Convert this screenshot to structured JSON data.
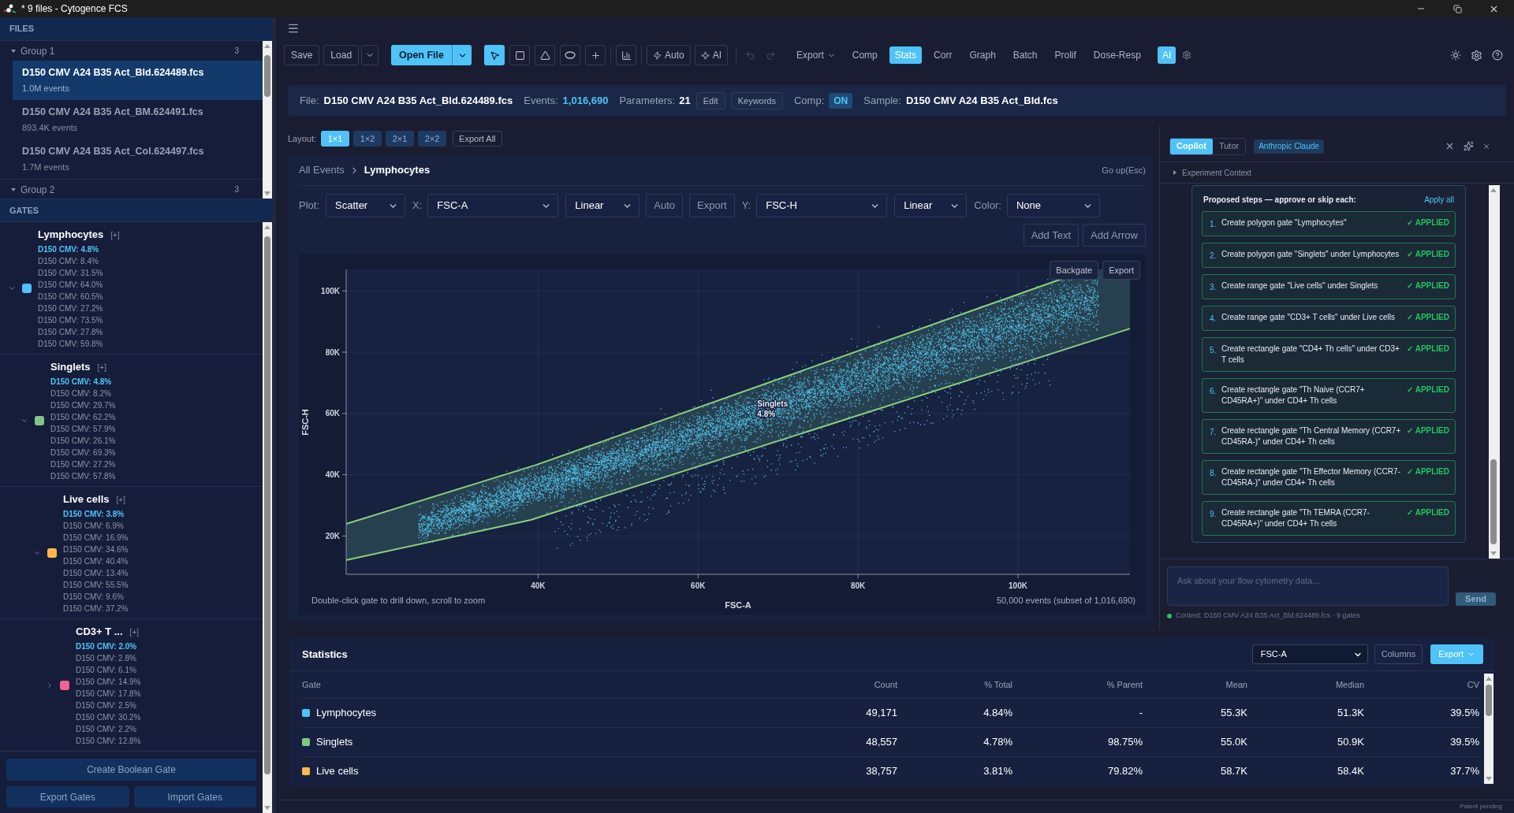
{
  "window": {
    "title": "* 9 files - Cytogence FCS"
  },
  "sidebar": {
    "files_header": "FILES",
    "file_groups": [
      {
        "name": "Group 1",
        "count": "3",
        "expanded": true,
        "files": [
          {
            "name": "D150 CMV A24 B35 Act_Bld.624489.fcs",
            "events": "1.0M events",
            "selected": true
          },
          {
            "name": "D150 CMV A24 B35 Act_BM.624491.fcs",
            "events": "893.4K events",
            "selected": false
          },
          {
            "name": "D150 CMV A24 B35 Act_Col.624497.fcs",
            "events": "1.7M events",
            "selected": false
          }
        ]
      },
      {
        "name": "Group 2",
        "count": "3",
        "expanded": true
      }
    ],
    "gates_header": "GATES",
    "gates": [
      {
        "name": "Lymphocytes",
        "add": "[+]",
        "color": "#4fc3f7",
        "expanded": true,
        "stats": [
          {
            "text": "D150 CMV: 4.8%",
            "selected": true
          },
          {
            "text": "D150 CMV: 8.4%",
            "selected": false
          },
          {
            "text": "D150 CMV: 31.5%",
            "selected": false
          },
          {
            "text": "D150 CMV: 64.0%",
            "selected": false
          },
          {
            "text": "D150 CMV: 60.5%",
            "selected": false
          },
          {
            "text": "D150 CMV: 27.2%",
            "selected": false
          },
          {
            "text": "D150 CMV: 73.5%",
            "selected": false
          },
          {
            "text": "D150 CMV: 27.8%",
            "selected": false
          },
          {
            "text": "D150 CMV: 59.8%",
            "selected": false
          }
        ],
        "children": [
          {
            "name": "Singlets",
            "add": "[+]",
            "color": "#81c784",
            "expanded": true,
            "stats": [
              {
                "text": "D150 CMV: 4.8%",
                "selected": true
              },
              {
                "text": "D150 CMV: 8.2%",
                "selected": false
              },
              {
                "text": "D150 CMV: 29.7%",
                "selected": false
              },
              {
                "text": "D150 CMV: 62.2%",
                "selected": false
              },
              {
                "text": "D150 CMV: 57.9%",
                "selected": false
              },
              {
                "text": "D150 CMV: 26.1%",
                "selected": false
              },
              {
                "text": "D150 CMV: 69.3%",
                "selected": false
              },
              {
                "text": "D150 CMV: 27.2%",
                "selected": false
              },
              {
                "text": "D150 CMV: 57.8%",
                "selected": false
              }
            ],
            "children": [
              {
                "name": "Live cells",
                "add": "[+]",
                "color": "#ffb74d",
                "expanded": true,
                "stats": [
                  {
                    "text": "D150 CMV: 3.8%",
                    "selected": true
                  },
                  {
                    "text": "D150 CMV: 6.9%",
                    "selected": false
                  },
                  {
                    "text": "D150 CMV: 16.9%",
                    "selected": false
                  },
                  {
                    "text": "D150 CMV: 34.6%",
                    "selected": false
                  },
                  {
                    "text": "D150 CMV: 40.4%",
                    "selected": false
                  },
                  {
                    "text": "D150 CMV: 13.4%",
                    "selected": false
                  },
                  {
                    "text": "D150 CMV: 55.5%",
                    "selected": false
                  },
                  {
                    "text": "D150 CMV: 9.6%",
                    "selected": false
                  },
                  {
                    "text": "D150 CMV: 37.2%",
                    "selected": false
                  }
                ],
                "children": [
                  {
                    "name": "CD3+ T ...",
                    "add": "[+]",
                    "color": "#f06292",
                    "expanded": false,
                    "stats": [
                      {
                        "text": "D150 CMV: 2.0%",
                        "selected": true
                      },
                      {
                        "text": "D150 CMV: 2.8%",
                        "selected": false
                      },
                      {
                        "text": "D150 CMV: 6.1%",
                        "selected": false
                      },
                      {
                        "text": "D150 CMV: 14.9%",
                        "selected": false
                      },
                      {
                        "text": "D150 CMV: 17.8%",
                        "selected": false
                      },
                      {
                        "text": "D150 CMV: 2.5%",
                        "selected": false
                      },
                      {
                        "text": "D150 CMV: 30.2%",
                        "selected": false
                      },
                      {
                        "text": "D150 CMV: 2.2%",
                        "selected": false
                      },
                      {
                        "text": "D150 CMV: 12.8%",
                        "selected": false
                      }
                    ]
                  }
                ]
              }
            ]
          }
        ]
      }
    ],
    "actions": {
      "create_boolean": "Create Boolean Gate",
      "export": "Export Gates",
      "import": "Import Gates"
    }
  },
  "toolbar": {
    "file_buttons": [
      "Save",
      "Load"
    ],
    "open_file": "Open File",
    "tools": [
      {
        "kind": "select",
        "selected": true
      },
      {
        "kind": "rectangle",
        "selected": false
      },
      {
        "kind": "polygon",
        "selected": false
      },
      {
        "kind": "ellipse",
        "selected": false
      },
      {
        "kind": "quadrant",
        "selected": false
      },
      {
        "kind": "histogram",
        "selected": false
      }
    ],
    "auto": "Auto",
    "ai_gate": "AI",
    "history": [
      {
        "kind": "undo",
        "disabled": true
      },
      {
        "kind": "redo",
        "disabled": true
      }
    ],
    "export": "Export",
    "views": [
      {
        "label": "Comp",
        "selected": false
      },
      {
        "label": "Stats",
        "selected": true
      },
      {
        "label": "Corr",
        "selected": false
      },
      {
        "label": "Graph",
        "selected": false
      },
      {
        "label": "Batch",
        "selected": false
      },
      {
        "label": "Prolif",
        "selected": false
      },
      {
        "label": "Dose-Resp",
        "selected": false
      }
    ],
    "ai_toggle": {
      "label": "AI",
      "on": true
    }
  },
  "file_info": {
    "file_label": "File:",
    "file": "D150 CMV A24 B35 Act_Bld.624489.fcs",
    "events_label": "Events:",
    "events": "1,016,690",
    "parameters_label": "Parameters:",
    "parameters": "21",
    "buttons": [
      "Edit",
      "Keywords"
    ],
    "comp_label": "Comp:",
    "comp": {
      "label": "ON",
      "on": true
    },
    "sample_label": "Sample:",
    "sample": "D150 CMV A24 B35 Act_Bld.fcs"
  },
  "layout": {
    "label": "Layout:",
    "options": [
      {
        "label": "1×1",
        "selected": true
      },
      {
        "label": "1×2",
        "selected": false
      },
      {
        "label": "2×1",
        "selected": false
      },
      {
        "label": "2×2",
        "selected": false
      }
    ],
    "export_all": "Export All"
  },
  "plot_panel": {
    "breadcrumb": [
      {
        "label": "All Events",
        "current": false
      },
      {
        "label": "Lymphocytes",
        "current": true
      }
    ],
    "go_up": "Go up(Esc)",
    "plot_type": {
      "label": "Plot:",
      "value": "Scatter"
    },
    "x_axis": {
      "label": "X:",
      "parameter": "FSC-A",
      "scale": "Linear"
    },
    "x_actions": [
      "Auto",
      "Export"
    ],
    "y_axis": {
      "label": "Y:",
      "parameter": "FSC-H",
      "scale": "Linear"
    },
    "color_by": {
      "label": "Color:",
      "value": "None"
    },
    "annotation_buttons": [
      "Add Text",
      "Add Arrow"
    ],
    "dot_plot": {
      "buttons": [
        "Backgate",
        "Export"
      ],
      "y_title": "FSC-H",
      "y_ticks": [
        "100K",
        "80K",
        "60K",
        "40K",
        "20K"
      ],
      "gate_label": "Singlets",
      "gate_percent": "4.8%",
      "x_ticks": [
        "40K",
        "60K",
        "80K",
        "100K"
      ],
      "x_title": "FSC-A",
      "hint": "Double-click gate to drill down, scroll to zoom",
      "event_count": "50,000 events (subset of 1,016,690)"
    }
  },
  "assistant_panel": {
    "tabs": [
      {
        "label": "Copilot",
        "selected": true
      },
      {
        "label": "Tutor",
        "selected": false
      }
    ],
    "model": "Anthropic Claude",
    "context_section": {
      "label": "Experiment Context",
      "expanded": false
    },
    "proposal": {
      "title": "Proposed steps — approve or skip each:",
      "apply_all": "Apply all",
      "steps": [
        {
          "number": "1.",
          "text": "Create polygon gate \"Lymphocytes\"",
          "status": "✓ APPLIED",
          "applied": true
        },
        {
          "number": "2.",
          "text": "Create polygon gate \"Singlets\" under Lymphocytes",
          "status": "✓ APPLIED",
          "applied": true
        },
        {
          "number": "3.",
          "text": "Create range gate \"Live cells\" under Singlets",
          "status": "✓ APPLIED",
          "applied": true
        },
        {
          "number": "4.",
          "text": "Create range gate \"CD3+ T cells\" under Live cells",
          "status": "✓ APPLIED",
          "applied": true
        },
        {
          "number": "5.",
          "text": "Create rectangle gate \"CD4+ Th cells\" under CD3+ T cells",
          "status": "✓ APPLIED",
          "applied": true
        },
        {
          "number": "6.",
          "text": "Create rectangle gate \"Th Naive (CCR7+ CD45RA+)\" under CD4+ Th cells",
          "status": "✓ APPLIED",
          "applied": true
        },
        {
          "number": "7.",
          "text": "Create rectangle gate \"Th Central Memory (CCR7+ CD45RA-)\" under CD4+ Th cells",
          "status": "✓ APPLIED",
          "applied": true
        },
        {
          "number": "8.",
          "text": "Create rectangle gate \"Th Effector Memory (CCR7- CD45RA-)\" under CD4+ Th cells",
          "status": "✓ APPLIED",
          "applied": true
        },
        {
          "number": "9.",
          "text": "Create rectangle gate \"Th TEMRA (CCR7- CD45RA+)\" under CD4+ Th cells",
          "status": "✓ APPLIED",
          "applied": true
        }
      ]
    },
    "input": {
      "placeholder": "Ask about your flow cytometry data..."
    },
    "send": {
      "label": "Send",
      "disabled": true
    },
    "context": {
      "text": "Context: D150 CMV A24 B35 Act_Bld.624489.fcs · 9 gates",
      "connected": true
    }
  },
  "statistics": {
    "title": "Statistics",
    "parameter": "FSC-A",
    "columns_button": "Columns",
    "export_button": "Export",
    "table": {
      "columns": [
        "Gate",
        "Count",
        "% Total",
        "% Parent",
        "Mean",
        "Median",
        "CV"
      ],
      "rows": [
        {
          "color": "#4fc3f7",
          "cells": [
            "Lymphocytes",
            "49,171",
            "4.84%",
            "-",
            "55.3K",
            "51.3K",
            "39.5%"
          ]
        },
        {
          "color": "#81c784",
          "cells": [
            "Singlets",
            "48,557",
            "4.78%",
            "98.75%",
            "55.0K",
            "50.9K",
            "39.5%"
          ]
        },
        {
          "color": "#ffb74d",
          "cells": [
            "Live cells",
            "38,757",
            "3.81%",
            "79.82%",
            "58.7K",
            "58.4K",
            "37.7%"
          ]
        }
      ]
    }
  },
  "footer": "Patent pending"
}
